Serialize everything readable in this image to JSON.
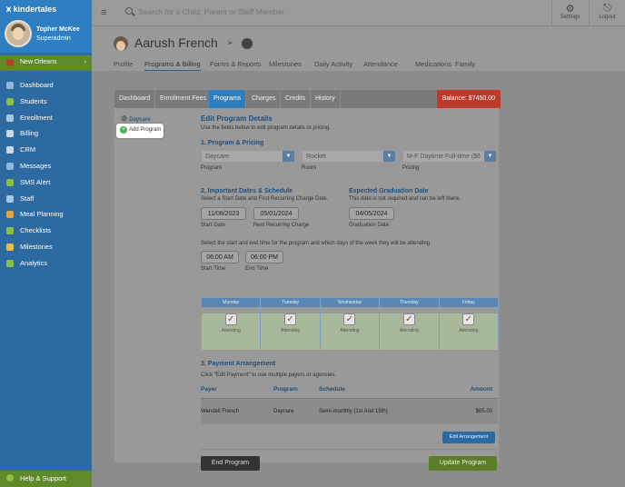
{
  "brand": {
    "name": "kindertales"
  },
  "user": {
    "name": "Topher McKee",
    "role": "Superadmin"
  },
  "location": {
    "name": "New Orleans"
  },
  "nav": [
    {
      "label": "Dashboard",
      "icon": "dashboard-icon",
      "color": "#8fb8dd"
    },
    {
      "label": "Students",
      "icon": "students-icon",
      "color": "#8fbf3f"
    },
    {
      "label": "Enrollment",
      "icon": "enrollment-icon",
      "color": "#a7c7e7"
    },
    {
      "label": "Billing",
      "icon": "billing-icon",
      "color": "#c8d8e8"
    },
    {
      "label": "CRM",
      "icon": "crm-icon",
      "color": "#c8d8e8"
    },
    {
      "label": "Messages",
      "icon": "messages-icon",
      "color": "#8fb8dd"
    },
    {
      "label": "SMS Alert",
      "icon": "sms-icon",
      "color": "#8fbf3f"
    },
    {
      "label": "Staff",
      "icon": "staff-icon",
      "color": "#a7c7e7"
    },
    {
      "label": "Meal Planning",
      "icon": "meal-icon",
      "color": "#e8a040"
    },
    {
      "label": "Checklists",
      "icon": "checklist-icon",
      "color": "#8fbf3f"
    },
    {
      "label": "Milestones",
      "icon": "star-icon",
      "color": "#e8c040"
    },
    {
      "label": "Analytics",
      "icon": "analytics-icon",
      "color": "#8fbf3f"
    }
  ],
  "help": {
    "label": "Help & Support"
  },
  "search": {
    "placeholder": "Search for a Child, Parent or Staff Member"
  },
  "topbar": {
    "settings": "Settings",
    "logout": "Logout"
  },
  "child": {
    "name": "Aarush French"
  },
  "profile_tabs": [
    "Profile",
    "Programs & Billing",
    "Forms & Reports",
    "Milestones",
    "Daily Activity",
    "Attendance",
    "Medications",
    "Family"
  ],
  "inner_tabs": [
    "Dashboard",
    "Enrollment Fees",
    "Programs",
    "Charges",
    "Credits",
    "History"
  ],
  "balance": "Balance: $7450.00",
  "left": {
    "daycare": "Daycare",
    "add_program": "Add Program"
  },
  "form": {
    "title": "Edit Program Details",
    "subtitle": "Use the fields below to edit program details or pricing.",
    "sec1": "1. Program & Pricing",
    "program_value": "Daycare",
    "program_label": "Program",
    "room_value": "Rocket",
    "room_label": "Room",
    "pricing_value": "M-F Daytime Full-time ($6",
    "pricing_label": "Pricing",
    "sec2": "2. Important Dates & Schedule",
    "sec2_note": "Select a Start Date and First Recurring Charge Date.",
    "start_date": "11/08/2023",
    "start_label": "Start Date",
    "next_charge": "05/01/2024",
    "next_label": "Next Recurring Charge",
    "grad_title": "Expected Graduation Date",
    "grad_note": "This date is not required and can be left blank.",
    "grad_date": "04/05/2024",
    "grad_label": "Graduation Date",
    "time_note": "Select the start and end time for the program and which days of the week they will be attending.",
    "start_time": "06:00 AM",
    "start_time_label": "Start Time",
    "end_time": "06:00 PM",
    "end_time_label": "End Time",
    "days": [
      "Monday",
      "Tuesday",
      "Wednesday",
      "Thursday",
      "Friday"
    ],
    "attending": "Attending",
    "sec3": "3. Payment Arrangement",
    "sec3_note": "Click \"Edit Payment\" to use multiple payers or agencies.",
    "pay_headers": [
      "Payer",
      "Program",
      "Schedule",
      "Amount"
    ],
    "pay_row": [
      "Wendell French",
      "Daycare",
      "Semi-monthly (1st And 15th)",
      "$65.00"
    ],
    "edit_arrangement": "Edit Arrangement",
    "end_program": "End Program",
    "update_program": "Update Program"
  }
}
